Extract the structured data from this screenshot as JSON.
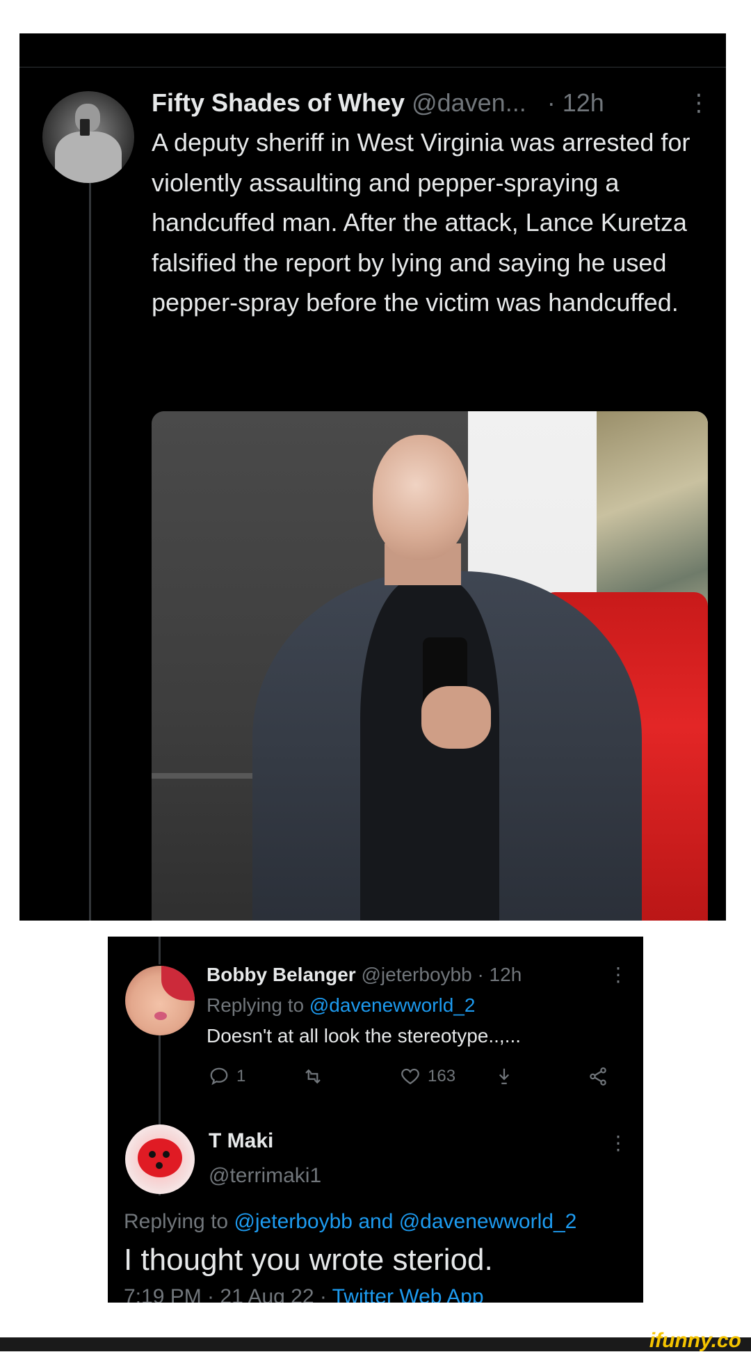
{
  "main_tweet": {
    "cut_header": "",
    "author_name": "Fifty Shades of Whey",
    "author_handle": "@daven...",
    "time": "· 12h",
    "more_icon": "more-vertical-icon",
    "text": "A deputy sheriff in West Virginia was arrested for violently assaulting and pepper-spraying a handcuffed man. After the attack, Lance Kuretza falsified the report by lying and saying he used pepper-spray before the victim was handcuffed."
  },
  "reply_1": {
    "author_name": "Bobby Belanger",
    "author_handle": "@jeterboybb",
    "time": "· 12h",
    "replying_prefix": "Replying to",
    "replying_to": "@davenewworld_2",
    "text": "Doesn't at all look the stereotype..,...",
    "actions": {
      "reply_count": "1",
      "like_count": "163"
    }
  },
  "reply_2": {
    "author_name": "T Maki",
    "author_handle": "@terrimaki1",
    "replying_prefix": "Replying to",
    "replying_to": "@jeterboybb and @davenewworld_2",
    "text": "I thought you wrote steriod.",
    "timestamp": "7:19 PM · 21 Aug 22 ·",
    "source": "Twitter Web App"
  },
  "watermark": "ifunny.co",
  "colors": {
    "background": "#000000",
    "text_primary": "#e7e9ea",
    "text_secondary": "#71767b",
    "link": "#1d9bf0",
    "watermark": "#f5c400"
  }
}
